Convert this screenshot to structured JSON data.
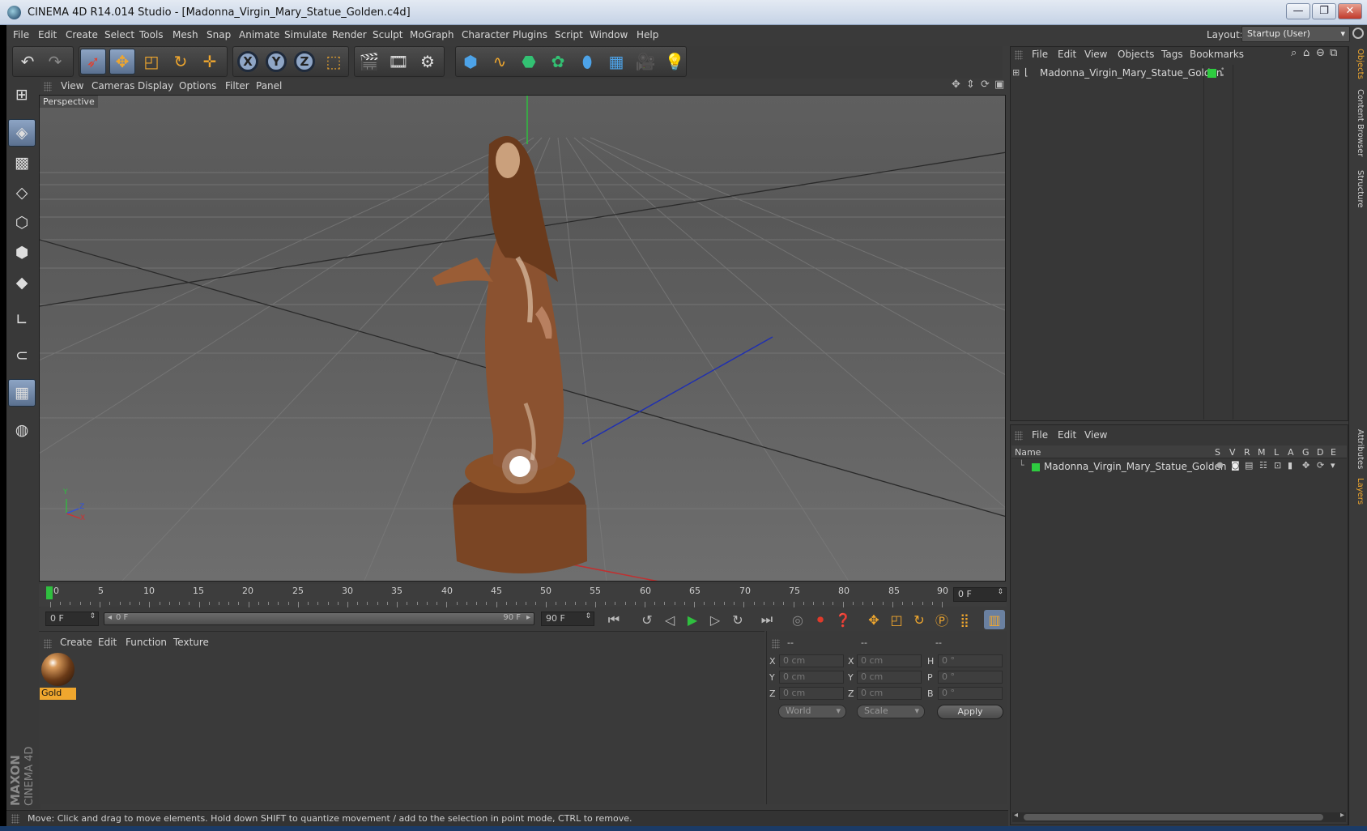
{
  "window": {
    "title": "CINEMA 4D R14.014 Studio - [Madonna_Virgin_Mary_Statue_Golden.c4d]",
    "minimize": "—",
    "restore": "❐",
    "close": "✕"
  },
  "menu": {
    "items": [
      "File",
      "Edit",
      "Create",
      "Select",
      "Tools",
      "Mesh",
      "Snap",
      "Animate",
      "Simulate",
      "Render",
      "Sculpt",
      "MoGraph",
      "Character",
      "Plugins",
      "Script",
      "Window",
      "Help"
    ],
    "layout_label": "Layout:",
    "layout_value": "Startup (User)"
  },
  "toolbar": {
    "axis_x": "X",
    "axis_y": "Y",
    "axis_z": "Z"
  },
  "viewport": {
    "menu": [
      "View",
      "Cameras",
      "Display",
      "Options",
      "Filter",
      "Panel"
    ],
    "label": "Perspective",
    "axis_y": "Y",
    "axis_z": "Z",
    "axis_x": "X"
  },
  "timeline": {
    "ticks": [
      "0",
      "5",
      "10",
      "15",
      "20",
      "25",
      "30",
      "35",
      "40",
      "45",
      "50",
      "55",
      "60",
      "65",
      "70",
      "75",
      "80",
      "85",
      "90"
    ],
    "current_frame": "0 F",
    "start_field": "0 F",
    "range_start": "0 F",
    "range_end": "90 F",
    "end_field": "90 F"
  },
  "materials": {
    "menu": [
      "Create",
      "Edit",
      "Function",
      "Texture"
    ],
    "items": [
      {
        "name": "Gold"
      }
    ]
  },
  "coordinates": {
    "headers": [
      "--",
      "--",
      "--"
    ],
    "rows": [
      {
        "a": "X",
        "av": "0 cm",
        "b": "X",
        "bv": "0 cm",
        "c": "H",
        "cv": "0 °"
      },
      {
        "a": "Y",
        "av": "0 cm",
        "b": "Y",
        "bv": "0 cm",
        "c": "P",
        "cv": "0 °"
      },
      {
        "a": "Z",
        "av": "0 cm",
        "b": "Z",
        "bv": "0 cm",
        "c": "B",
        "cv": "0 °"
      }
    ],
    "space": "World",
    "mode": "Scale",
    "apply": "Apply"
  },
  "objects": {
    "menu": [
      "File",
      "Edit",
      "View",
      "Objects",
      "Tags",
      "Bookmarks"
    ],
    "items": [
      {
        "name": "Madonna_Virgin_Mary_Statue_Golden"
      }
    ]
  },
  "layers": {
    "menu": [
      "File",
      "Edit",
      "View"
    ],
    "name_col": "Name",
    "flag_cols": [
      "S",
      "V",
      "R",
      "M",
      "L",
      "A",
      "G",
      "D",
      "E"
    ],
    "items": [
      {
        "name": "Madonna_Virgin_Mary_Statue_Golden"
      }
    ]
  },
  "side_tabs": [
    "Objects",
    "Content Browser",
    "Structure",
    "Attributes",
    "Layers"
  ],
  "brand": {
    "line1": "MAXON",
    "line2": "CINEMA 4D"
  },
  "status": "Move: Click and drag to move elements. Hold down SHIFT to quantize movement / add to the selection in point mode, CTRL to remove.",
  "colors": {
    "accent": "#f0a72e",
    "selected": "#8da4c4",
    "layer_green": "#2ecc40"
  }
}
